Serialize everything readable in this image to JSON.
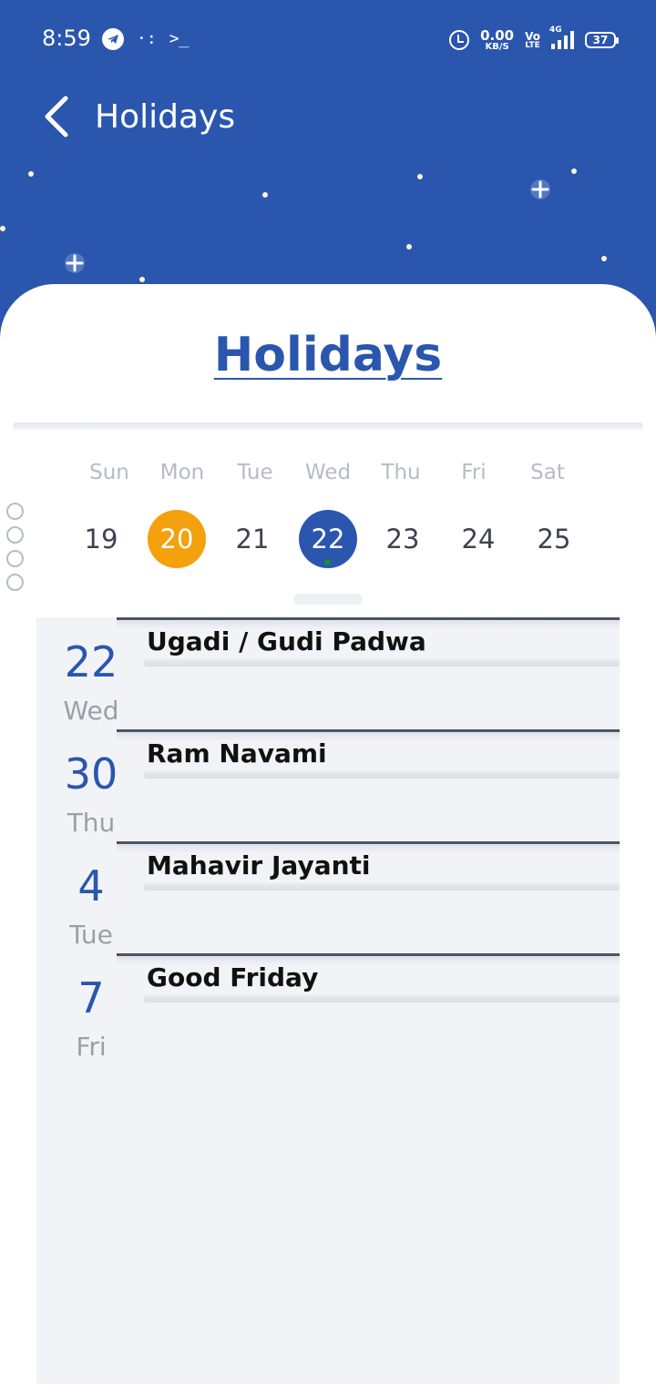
{
  "status_bar": {
    "time": "8:59",
    "net_speed_value": "0.00",
    "net_speed_unit": "KB/S",
    "volte_top": "Vo",
    "volte_bottom": "LTE",
    "network_type": "4G",
    "battery": "37"
  },
  "header": {
    "title": "Holidays",
    "background_color": "#2a56ae"
  },
  "card": {
    "title": "Holidays"
  },
  "week": {
    "days": [
      {
        "dow": "Sun",
        "date": "19",
        "state": "normal"
      },
      {
        "dow": "Mon",
        "date": "20",
        "state": "today"
      },
      {
        "dow": "Tue",
        "date": "21",
        "state": "normal"
      },
      {
        "dow": "Wed",
        "date": "22",
        "state": "selected"
      },
      {
        "dow": "Thu",
        "date": "23",
        "state": "normal"
      },
      {
        "dow": "Fri",
        "date": "24",
        "state": "normal"
      },
      {
        "dow": "Sat",
        "date": "25",
        "state": "normal"
      }
    ],
    "today_color": "#f5a00d",
    "selected_color": "#2a56ae",
    "event_dot_color": "#1e8a3e"
  },
  "holidays": [
    {
      "day": "22",
      "dow": "Wed",
      "name": "Ugadi / Gudi Padwa"
    },
    {
      "day": "30",
      "dow": "Thu",
      "name": "Ram Navami"
    },
    {
      "day": "4",
      "dow": "Tue",
      "name": "Mahavir Jayanti"
    },
    {
      "day": "7",
      "dow": "Fri",
      "name": "Good Friday"
    }
  ],
  "icons": {
    "back": "chevron-left-icon",
    "telegram": "telegram-icon",
    "alarm": "alarm-icon",
    "terminal": "terminal-icon"
  }
}
